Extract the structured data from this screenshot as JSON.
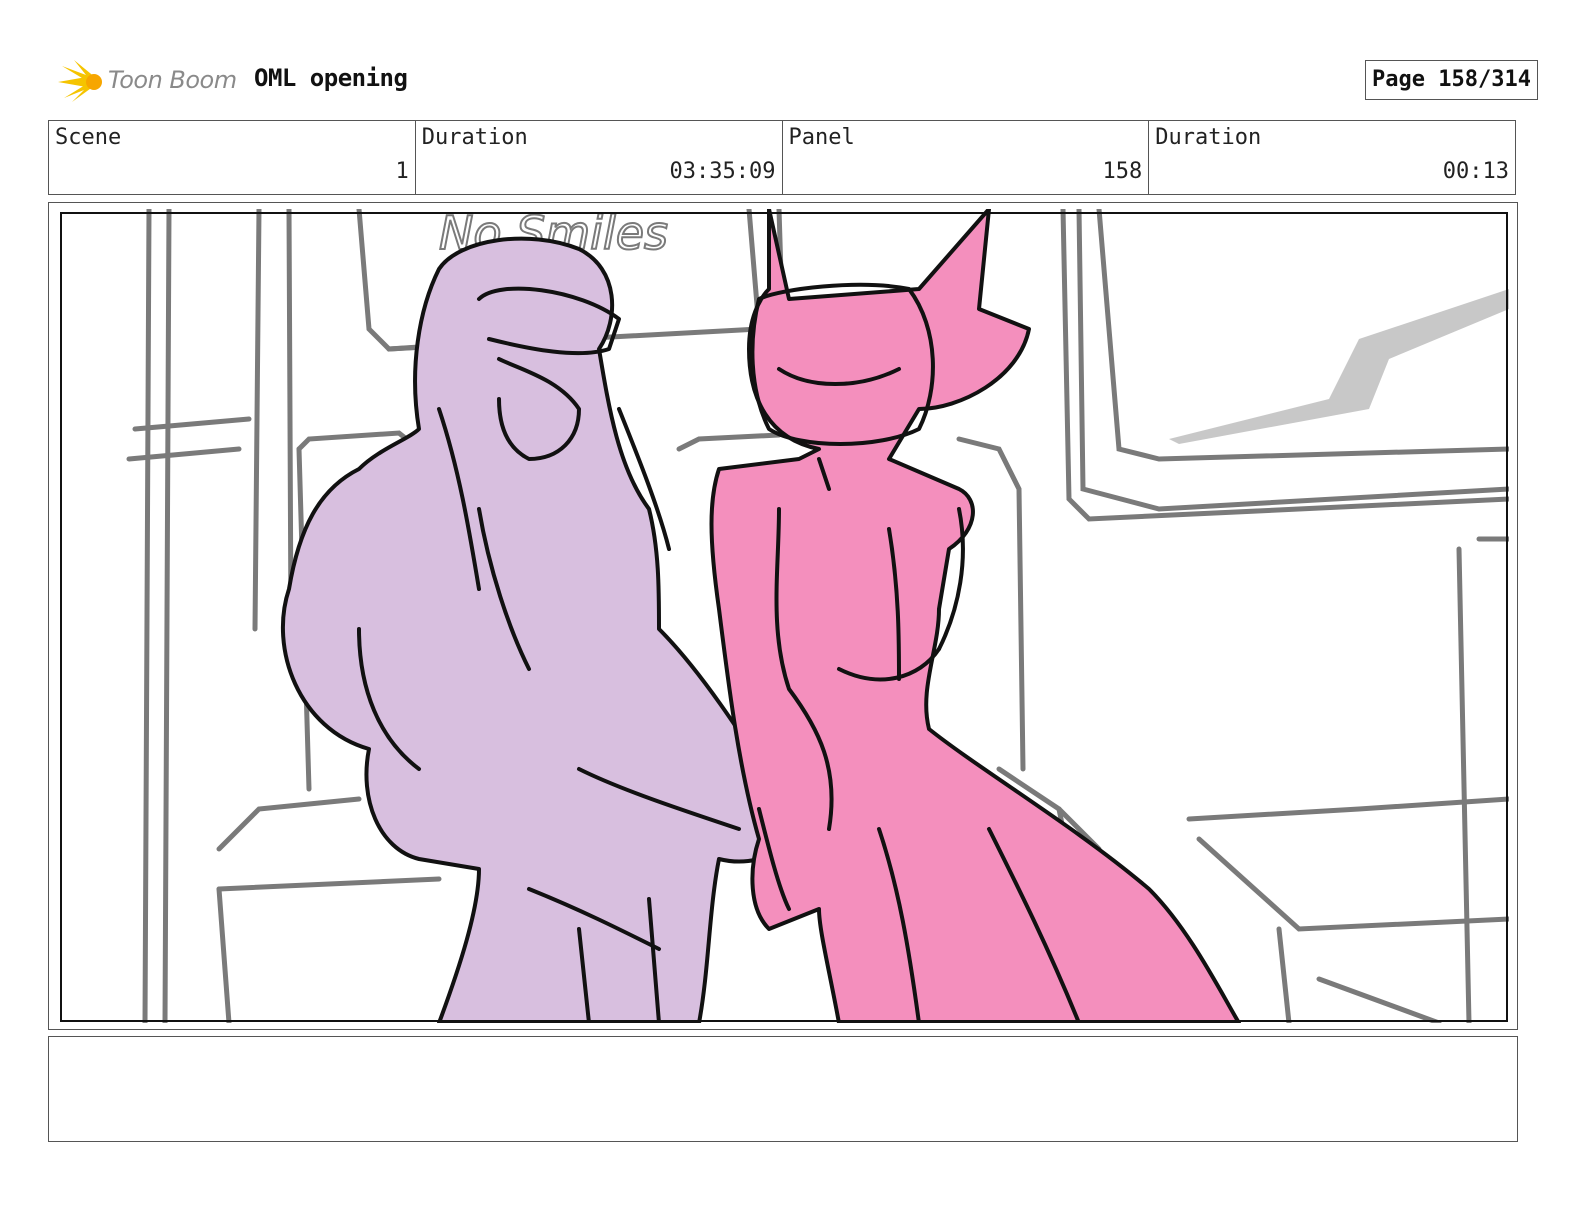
{
  "header": {
    "logo_text": "Toon Boom",
    "project_title": "OML opening",
    "page_label": "Page 158/314"
  },
  "info": {
    "scene_label": "Scene",
    "scene_value": "1",
    "scene_duration_label": "Duration",
    "scene_duration_value": "03:35:09",
    "panel_label": "Panel",
    "panel_value": "158",
    "panel_duration_label": "Duration",
    "panel_duration_value": "00:13"
  },
  "panel": {
    "sketch_text": "No Smiles",
    "colors": {
      "lavender": "#d8bfdf",
      "pink": "#f48fbd",
      "line": "#111111",
      "background_line": "#7a7a7a"
    }
  },
  "notes": {
    "text": ""
  }
}
